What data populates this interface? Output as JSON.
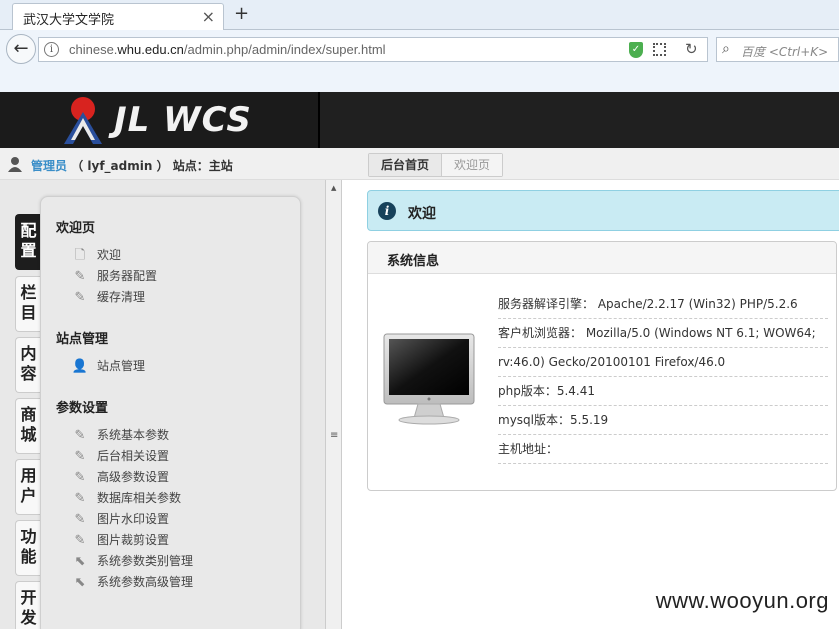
{
  "browser": {
    "tab_title": "武汉大学文学院",
    "tab_close": "×",
    "new_tab": "+",
    "back": "←",
    "url_prefix": "chinese.",
    "url_domain": "whu.edu.cn",
    "url_path": "/admin.php/admin/index/super.html",
    "search_placeholder": "百度 <Ctrl+K>"
  },
  "header": {
    "logo_text": "JL WCS"
  },
  "userbar": {
    "role": "管理员",
    "user": "（ lyf_admin ）",
    "site_label": "站点：主站"
  },
  "breadcrumb": {
    "home": "后台首页",
    "current": "欢迎页"
  },
  "vertical_tabs": [
    "配置",
    "栏目",
    "内容",
    "商城",
    "用户",
    "功能",
    "开发"
  ],
  "menu": {
    "groups": [
      {
        "title": "欢迎页",
        "items": [
          "欢迎",
          "服务器配置",
          "缓存清理"
        ]
      },
      {
        "title": "站点管理",
        "items": [
          "站点管理"
        ]
      },
      {
        "title": "参数设置",
        "items": [
          "系统基本参数",
          "后台相关设置",
          "高级参数设置",
          "数据库相关参数",
          "图片水印设置",
          "图片裁剪设置",
          "系统参数类别管理",
          "系统参数高级管理"
        ]
      }
    ]
  },
  "main": {
    "welcome": "欢迎",
    "sysinfo_title": "系统信息",
    "info": [
      "服务器解译引擎： Apache/2.2.17 (Win32) PHP/5.2.6",
      "客户机浏览器： Mozilla/5.0 (Windows NT 6.1; WOW64;",
      "rv:46.0) Gecko/20100101 Firefox/46.0",
      "php版本：5.4.41",
      "mysql版本：5.5.19",
      "主机地址："
    ]
  },
  "watermark": "www.wooyun.org",
  "colors": {
    "accent": "#3a8ec8",
    "header_bg": "#1b1b1b",
    "welcome_bg": "#c9ebf3"
  }
}
